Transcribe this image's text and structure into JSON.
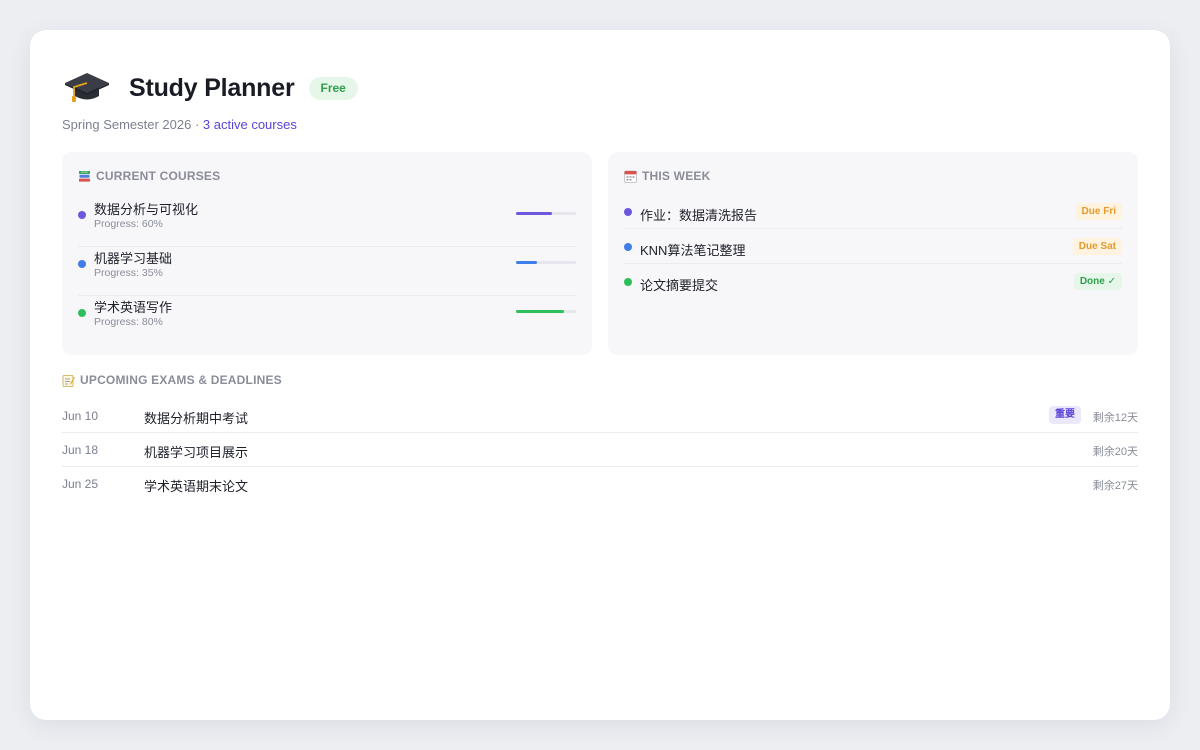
{
  "header": {
    "title": "Study Planner",
    "plan_badge": "Free",
    "logo_icon": "graduation-cap-icon",
    "subtitle_term": "Spring Semester 2026 · ",
    "subtitle_active": "3 active courses"
  },
  "courses_panel": {
    "heading": "CURRENT COURSES",
    "icon": "books-icon",
    "items": [
      {
        "name": "数据分析与可视化",
        "progress_label": "Progress: 60%",
        "progress": 0.6,
        "color": "#6c57dd"
      },
      {
        "name": "机器学习基础",
        "progress_label": "Progress: 35%",
        "progress": 0.35,
        "color": "#3f7ee8"
      },
      {
        "name": "学术英语写作",
        "progress_label": "Progress: 80%",
        "progress": 0.8,
        "color": "#2dbf5a"
      }
    ]
  },
  "week_panel": {
    "heading": "THIS WEEK",
    "icon": "calendar-icon",
    "items": [
      {
        "name": "作业：数据清洗报告",
        "tag": "Due Fri",
        "status": "due",
        "color": "#6c57dd"
      },
      {
        "name": "KNN算法笔记整理",
        "tag": "Due Sat",
        "status": "due",
        "color": "#3f7ee8"
      },
      {
        "name": "论文摘要提交",
        "tag": "Done ✓",
        "status": "done",
        "color": "#2dbf5a"
      }
    ]
  },
  "exams": {
    "heading": "UPCOMING EXAMS & DEADLINES",
    "icon": "memo-icon",
    "items": [
      {
        "date": "Jun 10",
        "name": "数据分析期中考试",
        "badge": "重要",
        "remaining": "剩余12天"
      },
      {
        "date": "Jun 18",
        "name": "机器学习项目展示",
        "remaining": "剩余20天"
      },
      {
        "date": "Jun 25",
        "name": "学术英语期末论文",
        "remaining": "剩余27天"
      }
    ]
  }
}
